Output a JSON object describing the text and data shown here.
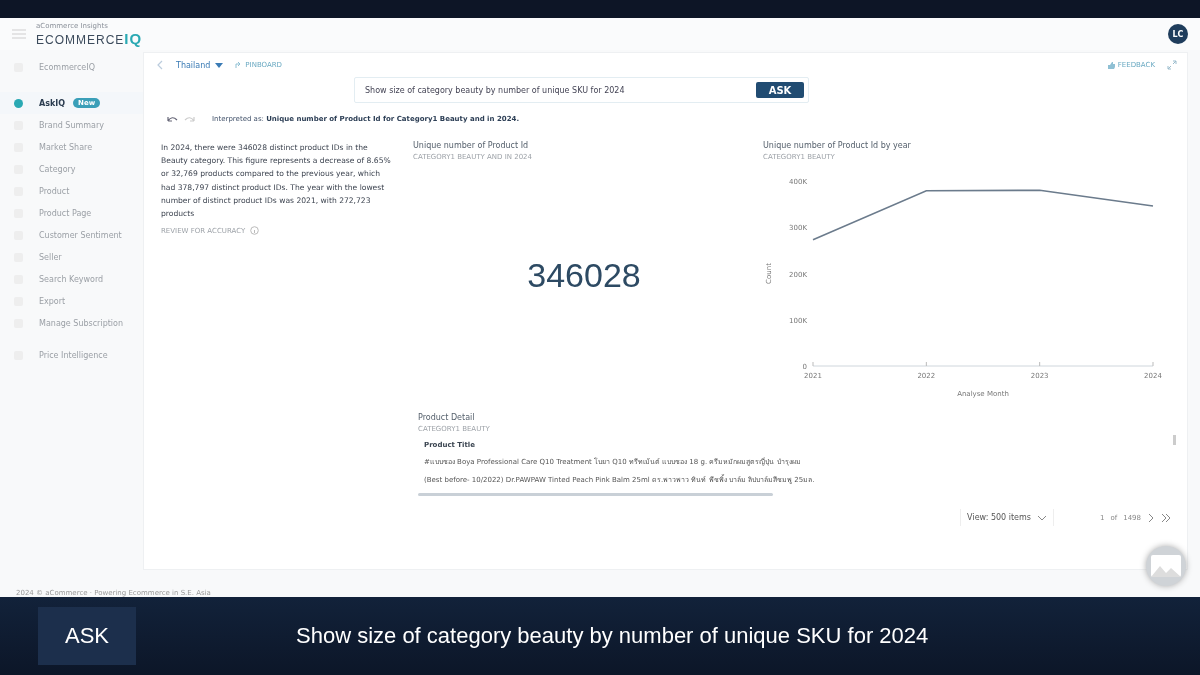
{
  "header": {
    "logo_tagline": "aCommerce Insights",
    "logo": "ECOMMERCE",
    "logo_accent": "IQ",
    "avatar": "LC"
  },
  "sidebar": {
    "items": [
      {
        "label": "EcommerceIQ",
        "selected": false
      },
      {
        "label": "AskIQ",
        "selected": true,
        "badge": "New"
      },
      {
        "label": "Brand Summary",
        "selected": false
      },
      {
        "label": "Market Share",
        "selected": false
      },
      {
        "label": "Category",
        "selected": false
      },
      {
        "label": "Product",
        "selected": false
      },
      {
        "label": "Product Page",
        "selected": false
      },
      {
        "label": "Customer Sentiment",
        "selected": false
      },
      {
        "label": "Seller",
        "selected": false
      },
      {
        "label": "Search Keyword",
        "selected": false
      },
      {
        "label": "Export",
        "selected": false
      },
      {
        "label": "Manage Subscription",
        "selected": false
      },
      {
        "label": "Price Intelligence",
        "selected": false
      }
    ]
  },
  "toolbar": {
    "country": "Thailand",
    "pinboard": "PINBOARD",
    "feedback": "FEEDBACK"
  },
  "query": {
    "value": "Show size of category beauty by number of unique SKU for 2024",
    "button": "ASK"
  },
  "interpretation": {
    "prefix": "Interpreted as:",
    "text": "Unique number of Product Id for Category1 Beauty and in 2024."
  },
  "summary": {
    "text": "In 2024, there were 346028 distinct product IDs in the Beauty category. This figure represents a decrease of 8.65% or 32,769 products compared to the previous year, which had 378,797 distinct product IDs. The year with the lowest number of distinct product IDs was 2021, with 272,723 products",
    "review": "REVIEW FOR ACCURACY"
  },
  "kpi": {
    "title": "Unique number of Product Id",
    "subtitle": "CATEGORY1 BEAUTY AND IN 2024",
    "value": "346028"
  },
  "line_chart": {
    "title": "Unique number of Product Id by year",
    "subtitle": "CATEGORY1 BEAUTY",
    "chart_data": {
      "type": "line",
      "xlabel": "Analyse Month",
      "ylabel": "Count",
      "categories": [
        "2021",
        "2022",
        "2023",
        "2024"
      ],
      "series": [
        {
          "color": "#6b7b8c",
          "values": [
            273000,
            379000,
            380000,
            346000
          ]
        }
      ],
      "ylim": [
        0,
        400000
      ],
      "yticks": [
        {
          "value": 0,
          "label": "0"
        },
        {
          "value": 100000,
          "label": "100K"
        },
        {
          "value": 200000,
          "label": "200K"
        },
        {
          "value": 300000,
          "label": "300K"
        },
        {
          "value": 400000,
          "label": "400K"
        }
      ]
    }
  },
  "product_detail": {
    "title": "Product Detail",
    "subtitle": "CATEGORY1 BEAUTY",
    "column": "Product Title",
    "rows": [
      "#แบบซอง Boya Professional Care Q10 Treatment โบยา Q10 ทรีทเม้นต์ แบบซอง 18 g. ครีมหมักผมสูตรญี่ปุ่น บำรุงผม",
      "(Best before- 10/2022) Dr.PAWPAW Tinted Peach Pink Balm 25ml ดร.พาวพาว ทินท์ พีชพิ้ง บาล์ม ลิปบาล์มสีชมพู 25มล."
    ],
    "view": "View: 500 items",
    "page": "1",
    "of": "of",
    "total": "1498"
  },
  "footer": "2024 © aCommerce · Powering Ecommerce in S.E. Asia",
  "caption": {
    "label": "ASK",
    "text": "Show size of category beauty by number of unique SKU for 2024"
  }
}
